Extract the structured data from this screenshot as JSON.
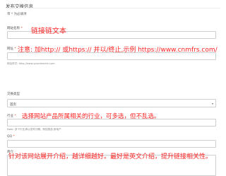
{
  "page": {
    "title": "发布交换信息"
  },
  "form": {
    "required_note": "带 * 为必填项",
    "link_name": {
      "label": "网站名称",
      "star": "*",
      "value": "链接链文本"
    },
    "url": {
      "label": "网址",
      "star": "*",
      "value": "注意: 加http:// 或https:// 并以/终止,示例 https://www.cnmfrs.com/",
      "hint": "网址样式: http://www.yourdomain.com"
    },
    "exchange_type": {
      "label": "交换类型",
      "selected": "首页"
    },
    "industry": {
      "label": "行业",
      "star": "*",
      "value": "选择网站产品所属相关的行业，可多选，但不乱选。",
      "hint": "Note: 多个行业请以逗号分隔，例如旅游,房地产"
    },
    "qq": {
      "label": "QQ",
      "star": "*"
    },
    "intro": {
      "label": "简介",
      "value": "针对该网站展开介绍，越详细越好。最好是英文介绍，提升链接相关性。"
    }
  },
  "colors": {
    "annotation": "#ff2222",
    "border": "#cfcfcf"
  }
}
